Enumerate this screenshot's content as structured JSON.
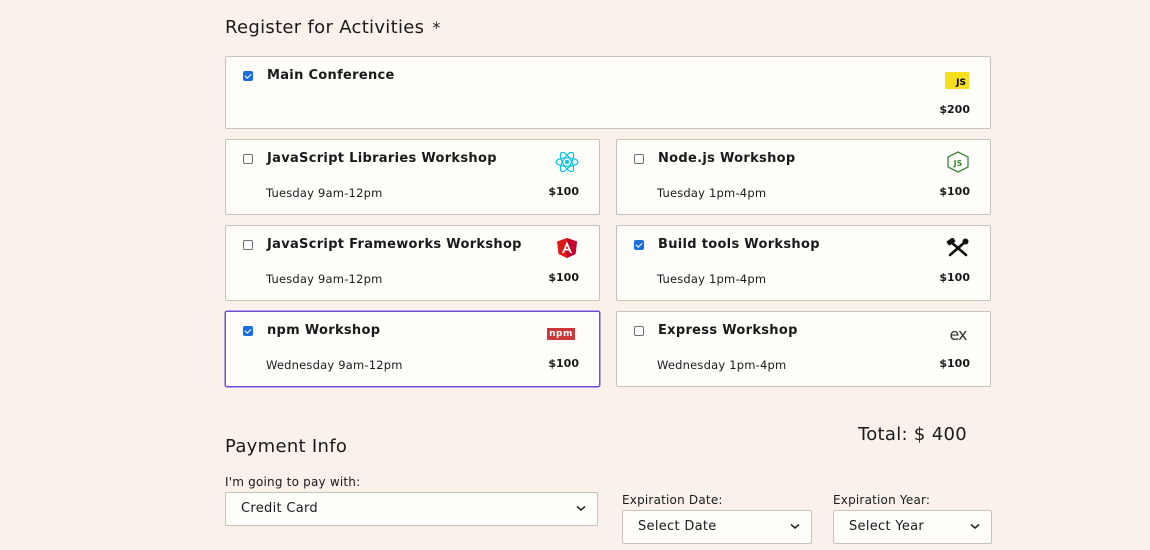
{
  "activities": {
    "title": "Register for Activities",
    "required_mark": "*",
    "main": {
      "name": "Main Conference",
      "price": "$200",
      "checked": true,
      "icon": "js-icon",
      "icon_text": "JS"
    },
    "workshops": [
      {
        "name": "JavaScript Libraries Workshop",
        "time": "Tuesday 9am-12pm",
        "price": "$100",
        "checked": false,
        "icon": "react-icon"
      },
      {
        "name": "Node.js Workshop",
        "time": "Tuesday 1pm-4pm",
        "price": "$100",
        "checked": false,
        "icon": "nodejs-icon"
      },
      {
        "name": "JavaScript Frameworks Workshop",
        "time": "Tuesday 9am-12pm",
        "price": "$100",
        "checked": false,
        "icon": "angular-icon"
      },
      {
        "name": "Build tools Workshop",
        "time": "Tuesday 1pm-4pm",
        "price": "$100",
        "checked": true,
        "icon": "build-tools-icon"
      },
      {
        "name": "npm Workshop",
        "time": "Wednesday 9am-12pm",
        "price": "$100",
        "checked": true,
        "icon": "npm-icon",
        "icon_text": "npm"
      },
      {
        "name": "Express Workshop",
        "time": "Wednesday 1pm-4pm",
        "price": "$100",
        "checked": false,
        "icon": "express-icon",
        "icon_text": "ex"
      }
    ],
    "total": "Total: $ 400"
  },
  "payment": {
    "title": "Payment Info",
    "method_label": "I'm going to pay with:",
    "method_value": "Credit Card",
    "exp_date_label": "Expiration Date:",
    "exp_date_value": "Select Date",
    "exp_year_label": "Expiration Year:",
    "exp_year_value": "Select Year"
  },
  "colors": {
    "background": "#faf2ea",
    "checkbox_checked": "#1a6fe0",
    "focus_border": "#6b4fd8",
    "react": "#00c4e8",
    "nodejs": "#3c873a",
    "angular": "#dd1b16",
    "npm": "#cb3837",
    "js": "#f7df1e"
  }
}
